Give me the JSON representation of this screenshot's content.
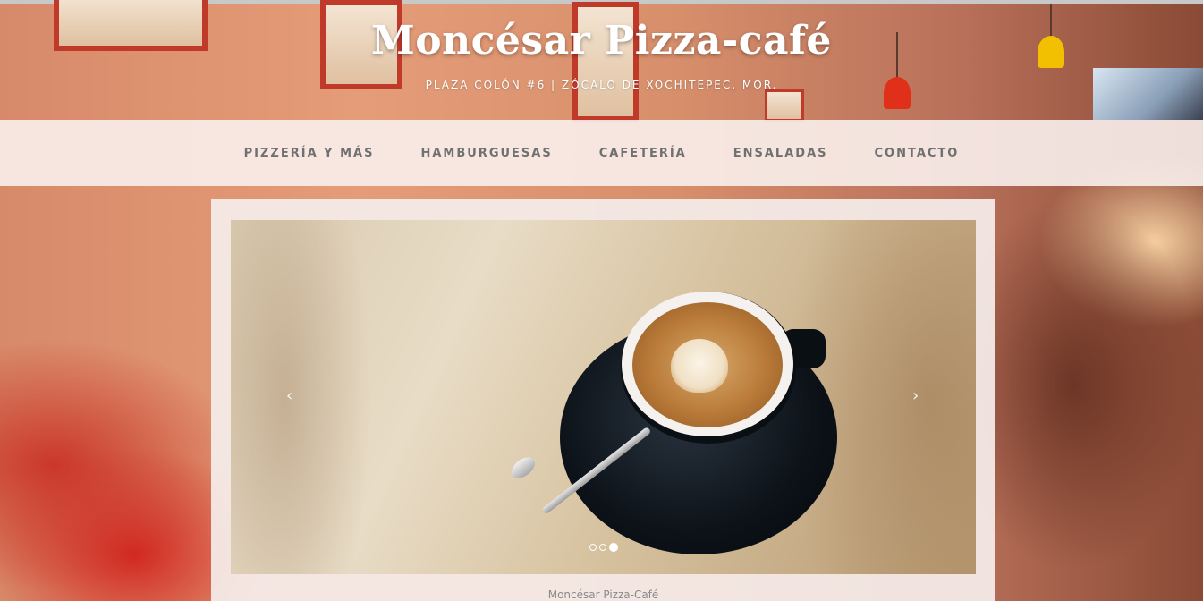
{
  "header": {
    "title": "Moncésar Pizza-café",
    "tagline": "PLAZA COLÓN #6 | ZÓCALO DE XOCHITEPEC, MOR."
  },
  "nav": {
    "items": [
      {
        "label": "PIZZERÍA Y MÁS"
      },
      {
        "label": "HAMBURGUESAS"
      },
      {
        "label": "CAFETERÍA"
      },
      {
        "label": "ENSALADAS"
      },
      {
        "label": "CONTACTO"
      }
    ]
  },
  "slider": {
    "prev_label": "‹",
    "next_label": "›",
    "current_slide": 3,
    "total_slides": 3,
    "caption": "Moncésar Pizza-Café"
  },
  "colors": {
    "nav_background": "#faf0ec",
    "nav_text": "#707070",
    "title_text": "#ffffff"
  },
  "icons": {
    "prev": "chevron-left-icon",
    "next": "chevron-right-icon"
  }
}
